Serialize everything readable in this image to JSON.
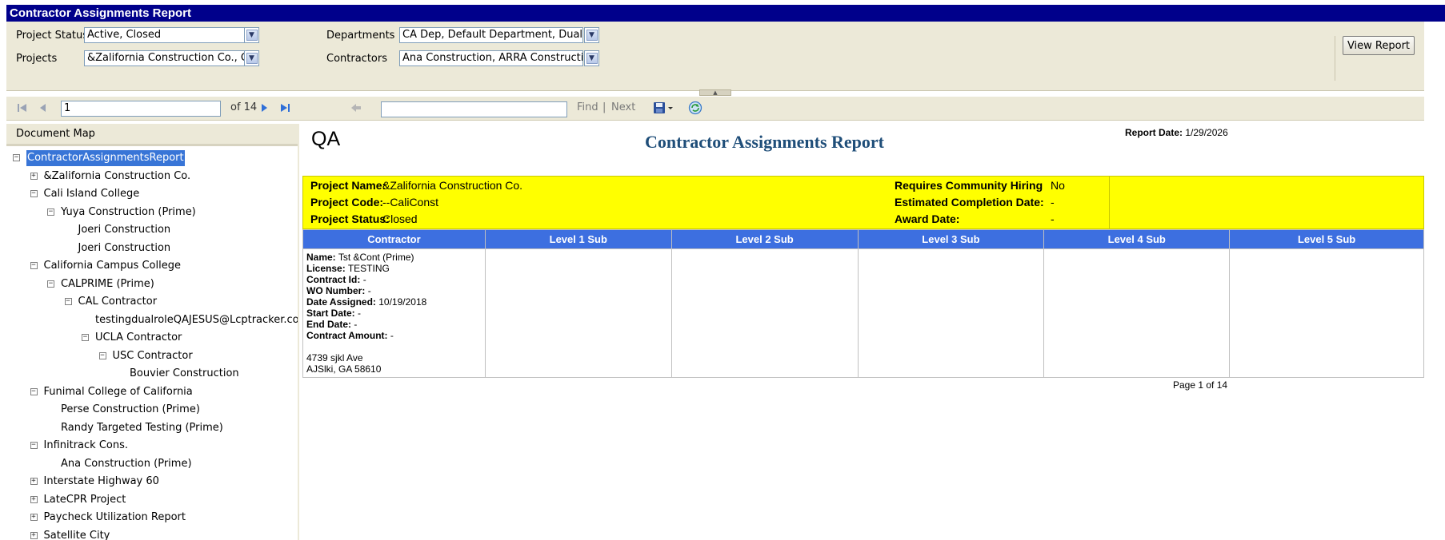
{
  "window": {
    "title": "Contractor Assignments Report"
  },
  "params": {
    "project_status_label": "Project Status",
    "project_status_value": "Active, Closed",
    "projects_label": "Projects",
    "projects_value": "&Zalifornia Construction Co., Cali Island College",
    "departments_label": "Departments",
    "departments_value": "CA Dep, Default Department, Dual Fund",
    "contractors_label": "Contractors",
    "contractors_value": "Ana Construction, ARRA Construction",
    "view_report_label": "View Report"
  },
  "toolbar": {
    "page_value": "1",
    "of_pages": "of 14",
    "find_placeholder": "",
    "find_label": "Find",
    "separator": "|",
    "next_label": "Next",
    "icons": [
      "first-page-icon",
      "previous-page-icon",
      "next-page-icon",
      "last-page-icon",
      "back-icon",
      "export-icon",
      "refresh-icon"
    ]
  },
  "docmap": {
    "header": "Document Map",
    "nodes": [
      {
        "label": "ContractorAssignmentsReport",
        "level": 0,
        "toggle": "−",
        "selected": true
      },
      {
        "label": "&Zalifornia Construction Co.",
        "level": 1,
        "toggle": "+"
      },
      {
        "label": "Cali Island College",
        "level": 1,
        "toggle": "−"
      },
      {
        "label": "Yuya Construction (Prime)",
        "level": 2,
        "toggle": "−"
      },
      {
        "label": "Joeri Construction",
        "level": 3,
        "toggle": ""
      },
      {
        "label": "Joeri Construction",
        "level": 3,
        "toggle": ""
      },
      {
        "label": "California Campus College",
        "level": 1,
        "toggle": "−"
      },
      {
        "label": "CALPRIME (Prime)",
        "level": 2,
        "toggle": "−"
      },
      {
        "label": "CAL Contractor",
        "level": 3,
        "toggle": "−"
      },
      {
        "label": "testingdualroleQAJESUS@Lcptracker.com",
        "level": 4,
        "toggle": ""
      },
      {
        "label": "UCLA Contractor",
        "level": 4,
        "toggle": "−"
      },
      {
        "label": "USC Contractor",
        "level": 5,
        "toggle": "−"
      },
      {
        "label": "Bouvier Construction",
        "level": 6,
        "toggle": ""
      },
      {
        "label": "Funimal College of California",
        "level": 1,
        "toggle": "−"
      },
      {
        "label": "Perse Construction (Prime)",
        "level": 2,
        "toggle": ""
      },
      {
        "label": "Randy Targeted Testing (Prime)",
        "level": 2,
        "toggle": ""
      },
      {
        "label": "Infinitrack Cons.",
        "level": 1,
        "toggle": "−"
      },
      {
        "label": "Ana Construction (Prime)",
        "level": 2,
        "toggle": ""
      },
      {
        "label": "Interstate Highway 60",
        "level": 1,
        "toggle": "+"
      },
      {
        "label": "LateCPR Project",
        "level": 1,
        "toggle": "+"
      },
      {
        "label": "Paycheck Utilization Report",
        "level": 1,
        "toggle": "+"
      },
      {
        "label": "Satellite City",
        "level": 1,
        "toggle": "+"
      }
    ]
  },
  "report": {
    "org": "QA",
    "title": "Contractor Assignments Report",
    "report_date_label": "Report Date:",
    "report_date_value": "1/29/2026",
    "project_name_label": "Project Name:",
    "project_name_value": "&Zalifornia Construction Co.",
    "project_code_label": "Project Code:",
    "project_code_value": "--CaliConst",
    "project_status_label": "Project Status:",
    "project_status_value": "Closed",
    "requires_hiring_label": "Requires Community Hiring",
    "requires_hiring_value": "No",
    "est_completion_label": "Estimated Completion Date:",
    "est_completion_value": "-",
    "award_date_label": "Award Date:",
    "award_date_value": "-",
    "columns": [
      "Contractor",
      "Level 1 Sub",
      "Level 2 Sub",
      "Level 3 Sub",
      "Level 4 Sub",
      "Level 5 Sub"
    ],
    "contractor": {
      "name_label": "Name:",
      "name": "Tst &Cont (Prime)",
      "license_label": "License:",
      "license": "TESTING",
      "contract_id_label": "Contract Id:",
      "contract_id": "-",
      "wo_label": "WO Number:",
      "wo": "-",
      "date_assigned_label": "Date Assigned:",
      "date_assigned": "10/19/2018",
      "start_label": "Start Date:",
      "start": "-",
      "end_label": "End Date:",
      "end": "-",
      "amount_label": "Contract Amount:",
      "amount": "-",
      "address1": "4739 sjkl Ave",
      "address2": "AJSlki, GA 58610"
    },
    "page_of": "Page 1 of 14"
  }
}
